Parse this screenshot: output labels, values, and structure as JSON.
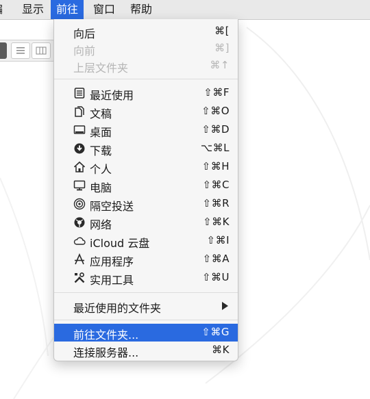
{
  "menubar": {
    "partial_label": "编辑",
    "items": [
      {
        "label": "显示"
      },
      {
        "label": "前往"
      },
      {
        "label": "窗口"
      },
      {
        "label": "帮助"
      }
    ],
    "active_index": 1
  },
  "go_menu": {
    "items": [
      {
        "label": "向后",
        "shortcut": "⌘[",
        "disabled": false,
        "icon": null
      },
      {
        "label": "向前",
        "shortcut": "⌘]",
        "disabled": true,
        "icon": null
      },
      {
        "label": "上层文件夹",
        "shortcut": "⌘↑",
        "disabled": true,
        "icon": null
      },
      {
        "label": "最近使用",
        "shortcut": "⇧⌘F",
        "icon": "recents-icon"
      },
      {
        "label": "文稿",
        "shortcut": "⇧⌘O",
        "icon": "documents-icon"
      },
      {
        "label": "桌面",
        "shortcut": "⇧⌘D",
        "icon": "desktop-icon"
      },
      {
        "label": "下载",
        "shortcut": "⌥⌘L",
        "icon": "downloads-icon"
      },
      {
        "label": "个人",
        "shortcut": "⇧⌘H",
        "icon": "home-icon"
      },
      {
        "label": "电脑",
        "shortcut": "⇧⌘C",
        "icon": "computer-icon"
      },
      {
        "label": "隔空投送",
        "shortcut": "⇧⌘R",
        "icon": "airdrop-icon"
      },
      {
        "label": "网络",
        "shortcut": "⇧⌘K",
        "icon": "network-icon"
      },
      {
        "label": "iCloud 云盘",
        "shortcut": "⇧⌘I",
        "icon": "icloud-icon"
      },
      {
        "label": "应用程序",
        "shortcut": "⇧⌘A",
        "icon": "applications-icon"
      },
      {
        "label": "实用工具",
        "shortcut": "⇧⌘U",
        "icon": "utilities-icon"
      },
      {
        "label": "最近使用的文件夹",
        "submenu": true
      },
      {
        "label": "前往文件夹...",
        "shortcut": "⇧⌘G",
        "selected": true
      },
      {
        "label": "连接服务器...",
        "shortcut": "⌘K"
      }
    ]
  },
  "colors": {
    "accent": "#2a6ae0",
    "menubar_bg": "#e9e9e9",
    "menu_bg": "#f6f6f6",
    "disabled_text": "#b5b5b5"
  }
}
